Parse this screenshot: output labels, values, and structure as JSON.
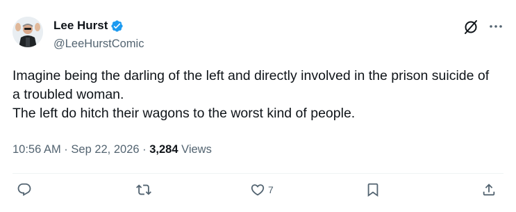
{
  "author": {
    "name": "Lee Hurst",
    "handle": "@LeeHurstComic"
  },
  "post": {
    "lines": [
      "Imagine being the darling of the left and directly involved in the prison suicide of a troubled woman.",
      "The left do hitch their wagons to the worst kind of people."
    ]
  },
  "meta": {
    "time": "10:56 AM",
    "sep1": " · ",
    "date": "Sep 22, 2026",
    "sep2": " · ",
    "views_count": "3,284",
    "views_label": " Views"
  },
  "actions": {
    "like_count": "7"
  },
  "colors": {
    "text": "#0f1419",
    "secondary": "#536471",
    "verified": "#1d9bf0",
    "divider": "#eff3f4"
  },
  "icons": {
    "verified": "verified-badge-icon",
    "grok": "grok-icon",
    "more": "more-dots-icon",
    "reply": "reply-icon",
    "repost": "repost-icon",
    "like": "heart-icon",
    "bookmark": "bookmark-icon",
    "share": "share-icon"
  }
}
